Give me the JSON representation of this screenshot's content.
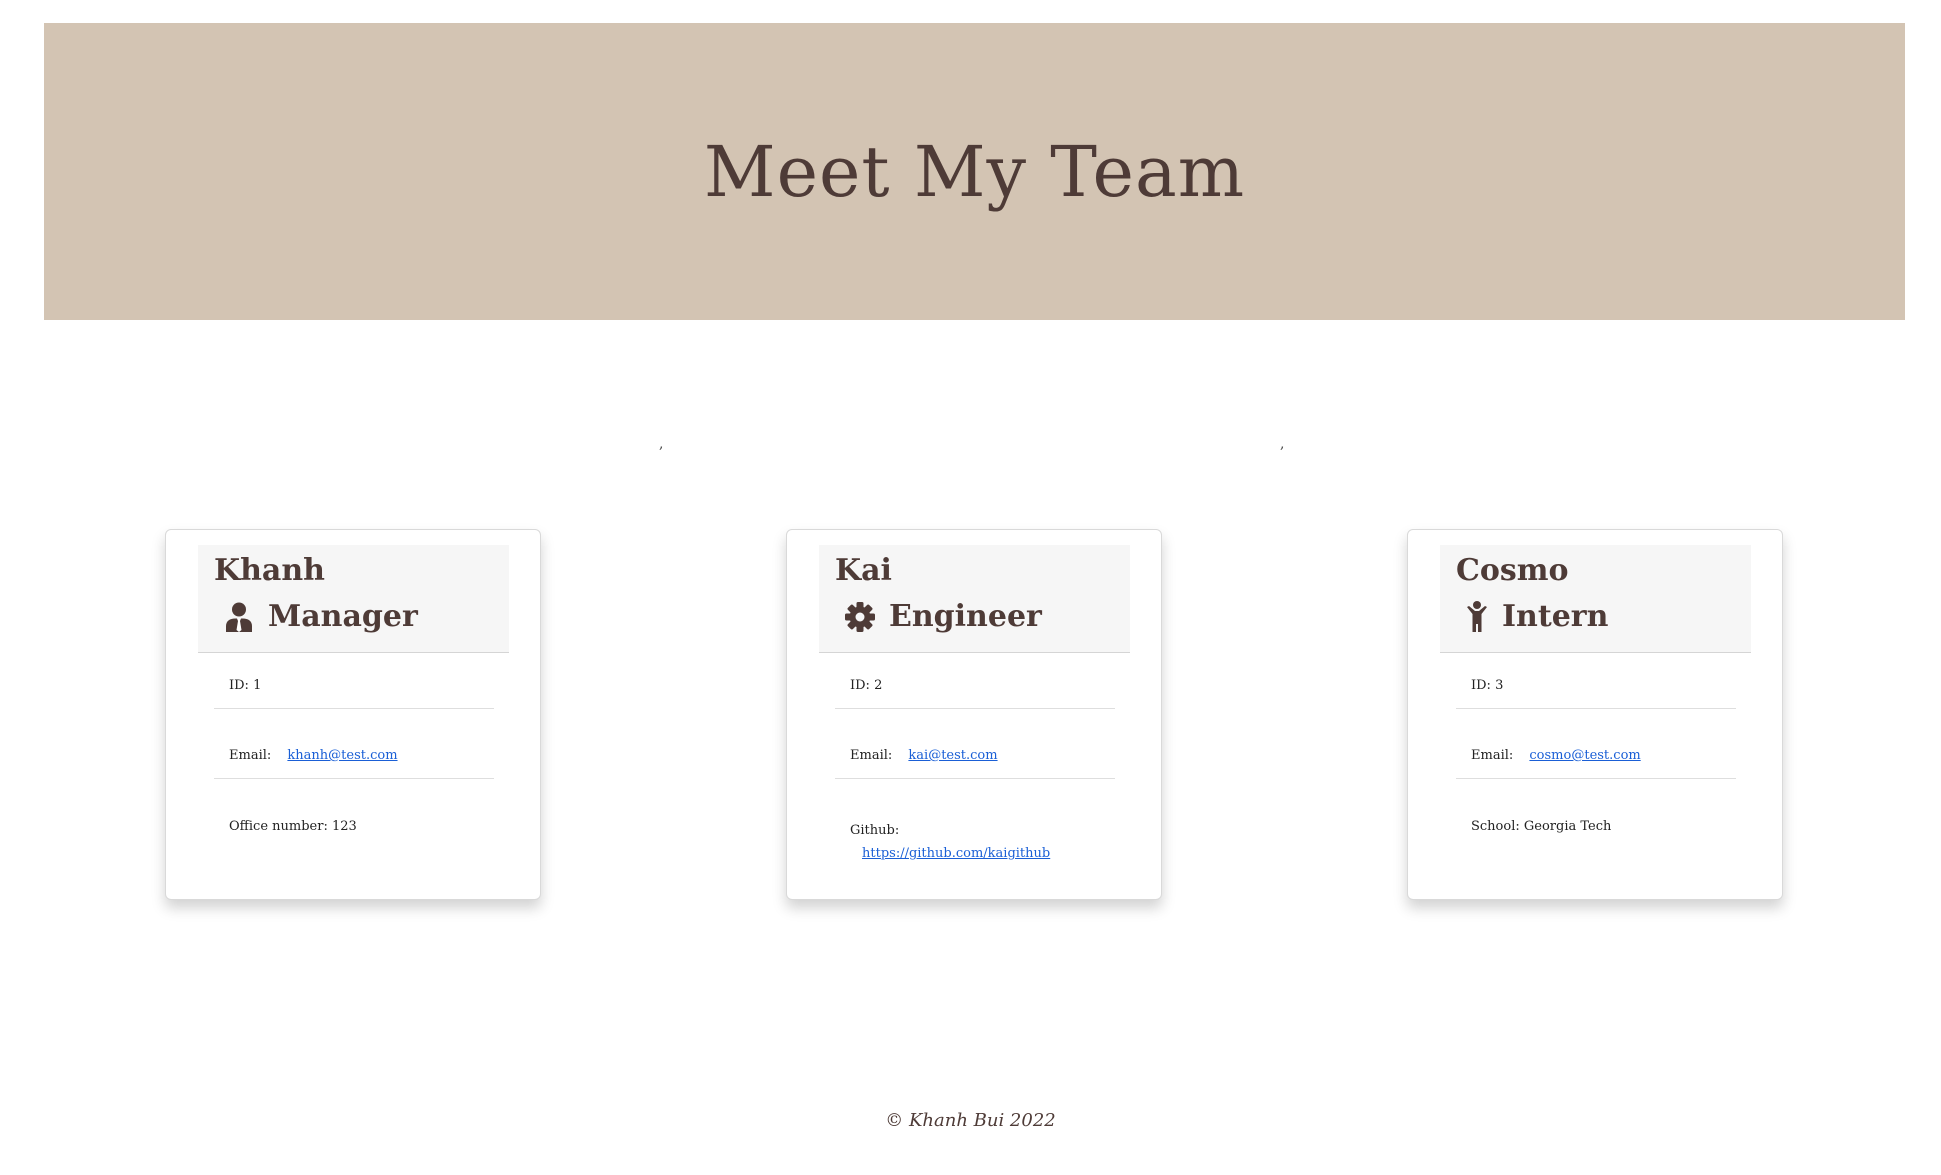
{
  "header": {
    "title": "Meet My Team"
  },
  "separators": [
    ",",
    ","
  ],
  "cards": [
    {
      "name": "Khanh",
      "role": "Manager",
      "role_icon": "manager-person-tie-icon",
      "id_text": "ID: 1",
      "email_label": "Email:",
      "email": "khanh@test.com",
      "extra_text": "Office number: 123"
    },
    {
      "name": "Kai",
      "role": "Engineer",
      "role_icon": "gear-icon",
      "id_text": "ID: 2",
      "email_label": "Email:",
      "email": "kai@test.com",
      "extra_label": "Github:",
      "extra_link": "https://github.com/kaigithub"
    },
    {
      "name": "Cosmo",
      "role": "Intern",
      "role_icon": "child-person-icon",
      "id_text": "ID: 3",
      "email_label": "Email:",
      "email": "cosmo@test.com",
      "extra_text": "School: Georgia Tech"
    }
  ],
  "footer": {
    "text": "© Khanh Bui 2022"
  },
  "colors": {
    "hero_bg": "#d3c4b3",
    "text_brown": "#4e3b37",
    "link": "#1a5fd6",
    "card_header_bg": "#f6f6f6"
  }
}
